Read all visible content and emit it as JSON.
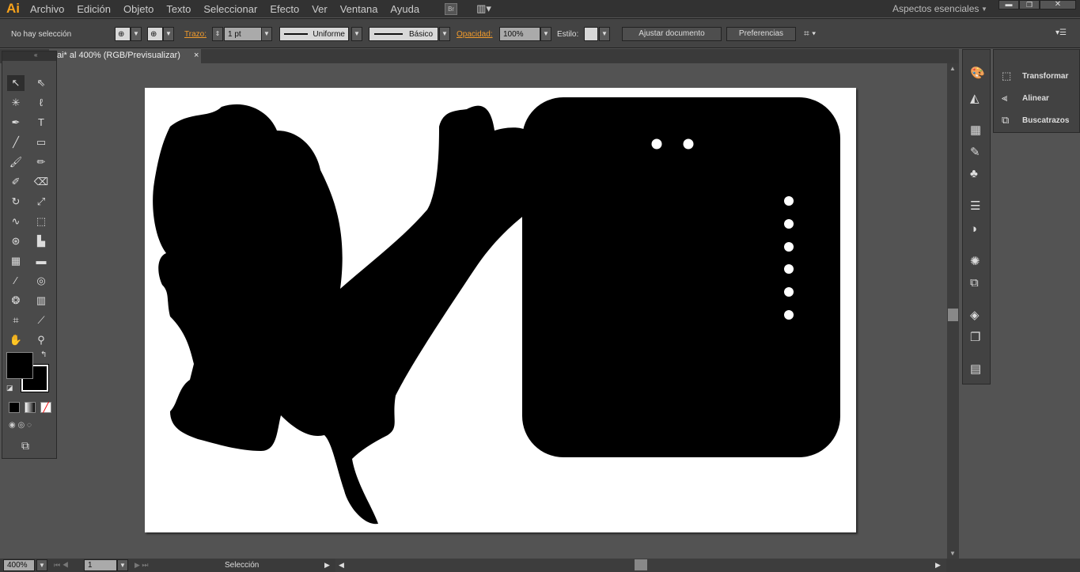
{
  "app": {
    "logo": "Ai",
    "workspace": "Aspectos esenciales"
  },
  "menu": [
    "Archivo",
    "Edición",
    "Objeto",
    "Texto",
    "Seleccionar",
    "Efecto",
    "Ver",
    "Ventana",
    "Ayuda"
  ],
  "bridge": "Br",
  "control": {
    "selection": "No hay selección",
    "stroke_label": "Trazo:",
    "stroke_value": "1 pt",
    "profile": "Uniforme",
    "brush": "Básico",
    "opacity_label": "Opacidad:",
    "opacity_value": "100%",
    "style_label": "Estilo:",
    "fit_button": "Ajustar documento",
    "prefs_button": "Preferencias"
  },
  "document_tab": {
    "title": "ai* al 400% (RGB/Previsualizar)",
    "close": "×"
  },
  "panels": [
    {
      "label": "Transformar"
    },
    {
      "label": "Alinear"
    },
    {
      "label": "Buscatrazos"
    }
  ],
  "status": {
    "zoom": "400%",
    "page": "1",
    "tool": "Selección"
  }
}
